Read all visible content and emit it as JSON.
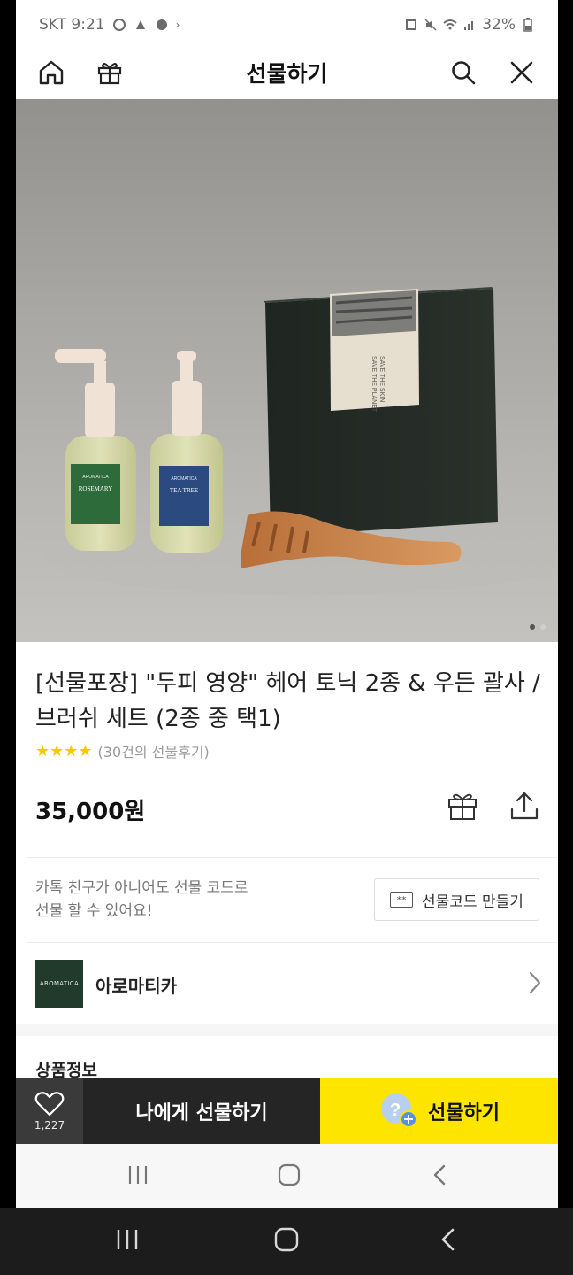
{
  "status_bar": {
    "carrier_time": "SKT 9:21",
    "battery": "32%"
  },
  "nav": {
    "title": "선물하기",
    "icons": [
      "home-icon",
      "gift-box-icon",
      "search-icon",
      "close-icon"
    ]
  },
  "hero": {
    "bottle1_brand": "AROMATICA",
    "bottle1_name": "ROSEMARY",
    "bottle2_brand": "AROMATICA",
    "bottle2_name": "TEA TREE",
    "box_text1": "SAVE THE SKIN",
    "box_text2": "SAVE THE PLANET",
    "carousel": {
      "total": 2,
      "active": 1
    }
  },
  "product": {
    "title": "[선물포장] \"두피 영양\" 헤어 토닉 2종 & 우든 괄사 / 브러쉬 세트 (2종 중 택1)",
    "stars": "★★★★",
    "rating": 4,
    "review_text": "(30건의 선물후기)",
    "price": "35,000원"
  },
  "gift_code": {
    "line1": "카톡 친구가 아니어도 선물 코드로",
    "line2": "선물 할 수 있어요!",
    "button_label": "선물코드 만들기",
    "button_icon": "**"
  },
  "brand": {
    "logo_text": "AROMATICA",
    "name": "아로마티카"
  },
  "section": {
    "title": "상품정보"
  },
  "actions": {
    "wish_count": "1,227",
    "self_gift_label": "나에게 선물하기",
    "gift_label": "선물하기"
  },
  "colors": {
    "accent": "#fee500",
    "dark_button": "#252525",
    "wish_bg": "#3a3a3a",
    "star": "#f5c800"
  }
}
